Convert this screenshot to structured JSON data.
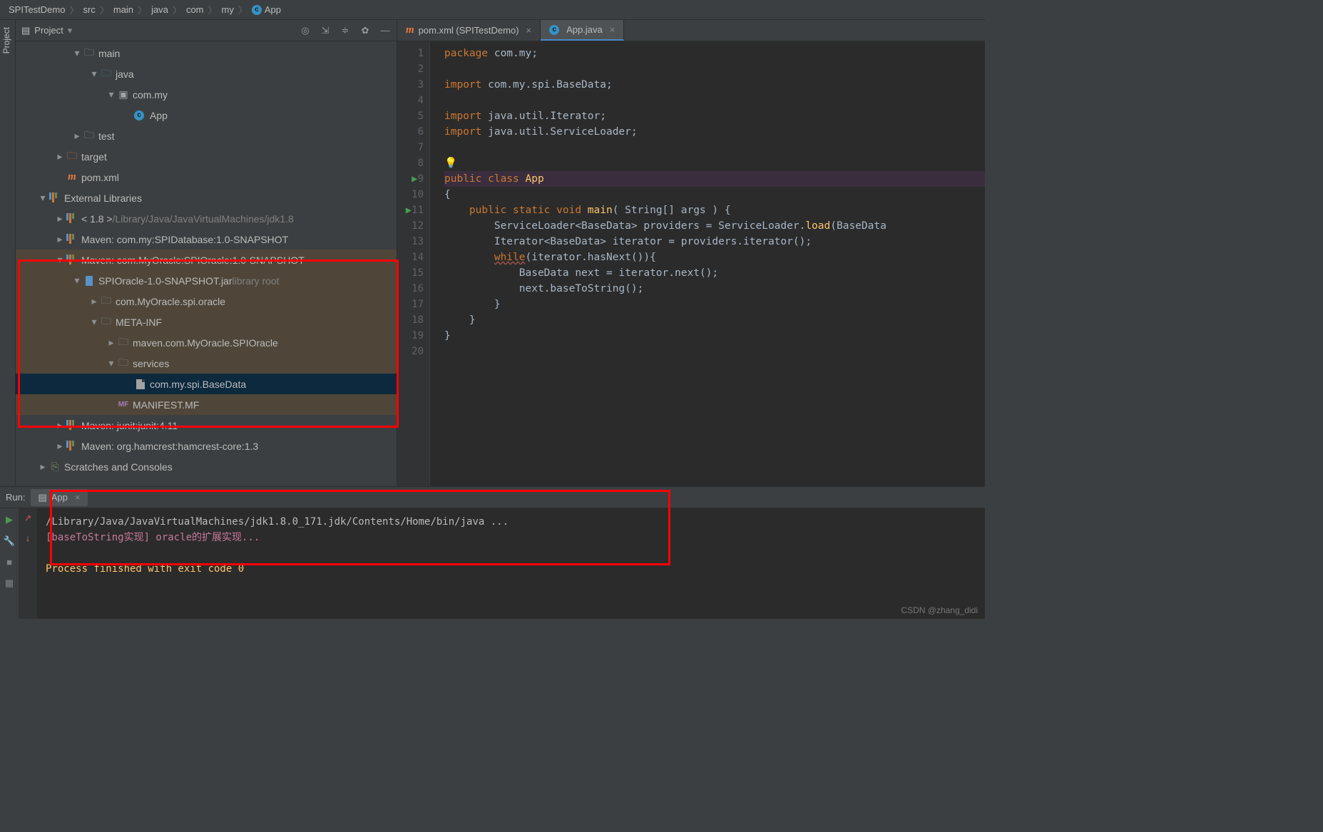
{
  "breadcrumb": [
    "SPITestDemo",
    "src",
    "main",
    "java",
    "com",
    "my",
    "App"
  ],
  "sideTab": "Project",
  "projectPanel": {
    "title": "Project",
    "tools": [
      "target-icon",
      "refresh-icon",
      "collapse-icon",
      "settings-icon",
      "hide-icon"
    ]
  },
  "tree": [
    {
      "indent": 3,
      "arrow": "▾",
      "iconType": "folder",
      "label": "main"
    },
    {
      "indent": 4,
      "arrow": "▾",
      "iconType": "folder-blue",
      "label": "java"
    },
    {
      "indent": 5,
      "arrow": "▾",
      "iconType": "package",
      "label": "com.my"
    },
    {
      "indent": 6,
      "arrow": "",
      "iconType": "class",
      "label": "App"
    },
    {
      "indent": 3,
      "arrow": "▸",
      "iconType": "folder",
      "label": "test"
    },
    {
      "indent": 2,
      "arrow": "▸",
      "iconType": "folder-orange",
      "label": "target"
    },
    {
      "indent": 2,
      "arrow": "",
      "iconType": "maven",
      "label": "pom.xml"
    },
    {
      "indent": 1,
      "arrow": "▾",
      "iconType": "lib",
      "label": "External Libraries"
    },
    {
      "indent": 2,
      "arrow": "▸",
      "iconType": "lib",
      "label": "< 1.8 >",
      "extra": "/Library/Java/JavaVirtualMachines/jdk1.8"
    },
    {
      "indent": 2,
      "arrow": "▸",
      "iconType": "lib",
      "label": "Maven: com.my:SPIDatabase:1.0-SNAPSHOT"
    },
    {
      "indent": 2,
      "arrow": "▾",
      "iconType": "lib",
      "label": "Maven: com.MyOracle:SPIOracle:1.0-SNAPSHOT",
      "hl": true
    },
    {
      "indent": 3,
      "arrow": "▾",
      "iconType": "jar",
      "label": "SPIOracle-1.0-SNAPSHOT.jar",
      "extra": "library root",
      "hl": true
    },
    {
      "indent": 4,
      "arrow": "▸",
      "iconType": "folder",
      "label": "com.MyOracle.spi.oracle",
      "hl": true
    },
    {
      "indent": 4,
      "arrow": "▾",
      "iconType": "folder",
      "label": "META-INF",
      "hl": true
    },
    {
      "indent": 5,
      "arrow": "▸",
      "iconType": "folder",
      "label": "maven.com.MyOracle.SPIOracle",
      "hl": true
    },
    {
      "indent": 5,
      "arrow": "▾",
      "iconType": "folder",
      "label": "services",
      "hl": true
    },
    {
      "indent": 6,
      "arrow": "",
      "iconType": "text",
      "label": "com.my.spi.BaseData",
      "hl": true,
      "selected": true
    },
    {
      "indent": 5,
      "arrow": "",
      "iconType": "manifest",
      "label": "MANIFEST.MF",
      "hl": true
    },
    {
      "indent": 2,
      "arrow": "▸",
      "iconType": "lib",
      "label": "Maven: junit:junit:4.11"
    },
    {
      "indent": 2,
      "arrow": "▸",
      "iconType": "lib",
      "label": "Maven: org.hamcrest:hamcrest-core:1.3"
    },
    {
      "indent": 1,
      "arrow": "▸",
      "iconType": "scratch",
      "label": "Scratches and Consoles"
    }
  ],
  "editorTabs": [
    {
      "icon": "maven",
      "label": "pom.xml (SPITestDemo)",
      "active": false
    },
    {
      "icon": "class",
      "label": "App.java",
      "active": true
    }
  ],
  "code": {
    "lines": [
      {
        "n": 1,
        "c": "<span class='k'>package </span><span class='imp'>com.my</span>;"
      },
      {
        "n": 2,
        "c": ""
      },
      {
        "n": 3,
        "c": "<span class='k'>import </span><span class='imp'>com.my.spi.BaseData</span>;"
      },
      {
        "n": 4,
        "c": ""
      },
      {
        "n": 5,
        "c": "<span class='k'>import </span><span class='imp'>java.util.Iterator</span>;"
      },
      {
        "n": 6,
        "c": "<span class='k'>import </span><span class='imp'>java.util.ServiceLoader</span>;"
      },
      {
        "n": 7,
        "c": ""
      },
      {
        "n": 8,
        "c": "<span class='bulb'>💡</span>",
        "bulb": true
      },
      {
        "n": 9,
        "c": "<span class='k'>public class </span><span class='fn'>App</span>",
        "hl": true,
        "run": true
      },
      {
        "n": 10,
        "c": "{"
      },
      {
        "n": 11,
        "c": "    <span class='k'>public static void </span><span class='fn'>main</span>( String[] args ) {",
        "run": true
      },
      {
        "n": 12,
        "c": "        ServiceLoader&lt;BaseData&gt; providers = ServiceLoader.<span class='fn'>load</span>(BaseData"
      },
      {
        "n": 13,
        "c": "        Iterator&lt;BaseData&gt; iterator = providers.iterator();"
      },
      {
        "n": 14,
        "c": "        <span class='k underline-err'>while</span>(iterator.hasNext()){"
      },
      {
        "n": 15,
        "c": "            BaseData next = iterator.next();"
      },
      {
        "n": 16,
        "c": "            next.baseToString();"
      },
      {
        "n": 17,
        "c": "        }"
      },
      {
        "n": 18,
        "c": "    }"
      },
      {
        "n": 19,
        "c": "}"
      },
      {
        "n": 20,
        "c": ""
      }
    ]
  },
  "runPanel": {
    "label": "Run:",
    "tab": "App",
    "output": {
      "cmd": "/Library/Java/JavaVirtualMachines/jdk1.8.0_171.jdk/Contents/Home/bin/java ...",
      "log": "[baseToString实现] oracle的扩展实现...",
      "exit": "Process finished with exit code 0"
    }
  },
  "watermark": "CSDN @zhang_didi"
}
